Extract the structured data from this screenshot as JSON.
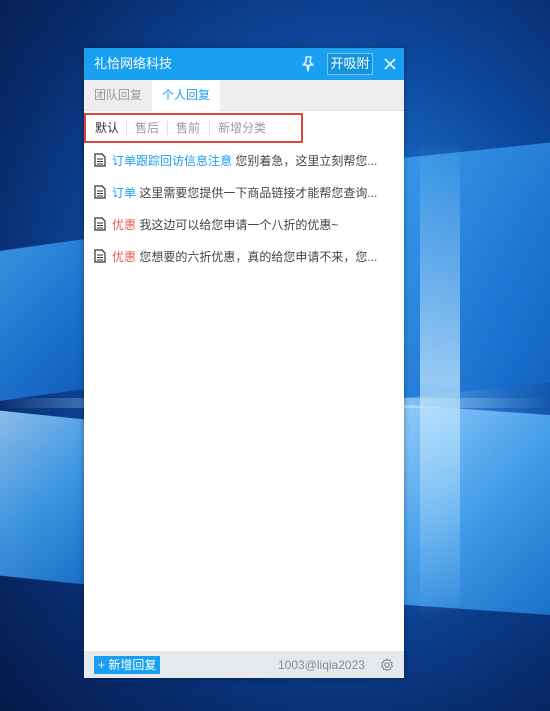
{
  "window": {
    "title": "礼恰网络科技",
    "open_button_label": "开吸附"
  },
  "tabs": [
    {
      "label": "团队回复",
      "active": false
    },
    {
      "label": "个人回复",
      "active": true
    }
  ],
  "categories": [
    {
      "label": "默认",
      "selected": true
    },
    {
      "label": "售后",
      "selected": false
    },
    {
      "label": "售前",
      "selected": false
    },
    {
      "label": "新增分类",
      "selected": false
    }
  ],
  "replies": [
    {
      "tag": "订单跟踪回访信息注意",
      "tag_color": "blue",
      "text": "您别着急，这里立刻帮您..."
    },
    {
      "tag": "订单",
      "tag_color": "blue",
      "text": "这里需要您提供一下商品链接才能帮您查询..."
    },
    {
      "tag": "优惠",
      "tag_color": "red",
      "text": "我这边可以给您申请一个八折的优惠~"
    },
    {
      "tag": "优惠",
      "tag_color": "red",
      "text": "您想要的六折优惠，真的给您申请不来，您..."
    }
  ],
  "footer": {
    "add_button_label": "+ 新增回复",
    "account": "1003@liqia2023"
  },
  "icons": {
    "pin": "pin-icon",
    "close": "close-icon",
    "document": "document-icon",
    "gear": "gear-icon"
  },
  "colors": {
    "accent": "#1aa0f0",
    "tag_red": "#ee5a52",
    "highlight_outline": "#e0423c"
  }
}
